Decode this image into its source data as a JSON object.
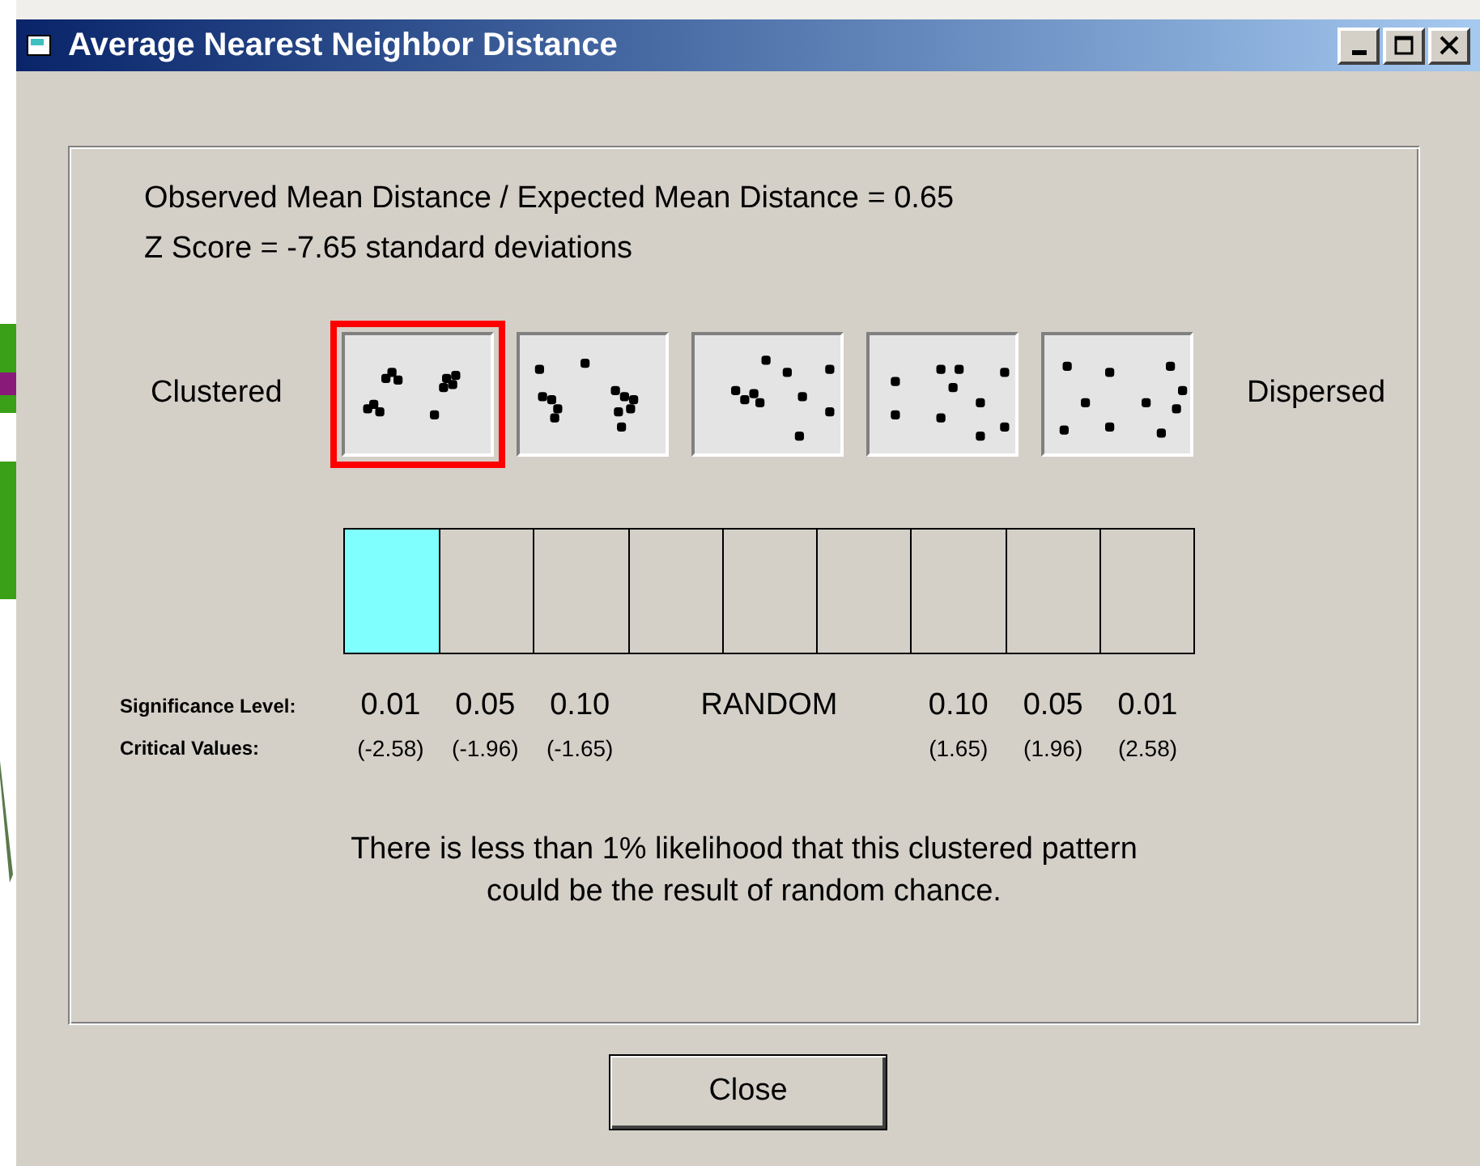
{
  "window": {
    "title": "Average Nearest Neighbor Distance"
  },
  "summary": [
    "Observed Mean Distance / Expected Mean Distance = 0.65",
    "Z Score = -7.65 standard deviations"
  ],
  "ends": {
    "left": "Clustered",
    "right": "Dispersed"
  },
  "patterns": [
    {
      "selected": true
    },
    {
      "selected": false
    },
    {
      "selected": false
    },
    {
      "selected": false
    },
    {
      "selected": false
    }
  ],
  "scale": {
    "cells": [
      {
        "selected": true
      },
      {
        "selected": false
      },
      {
        "selected": false
      },
      {
        "selected": false
      },
      {
        "selected": false
      },
      {
        "selected": false
      },
      {
        "selected": false
      },
      {
        "selected": false
      },
      {
        "selected": false
      }
    ],
    "significance_heading": "Significance Level:",
    "critical_heading": "Critical Values:",
    "columns": [
      {
        "kind": "level",
        "significance": "0.01",
        "critical": "(-2.58)"
      },
      {
        "kind": "level",
        "significance": "0.05",
        "critical": "(-1.96)"
      },
      {
        "kind": "level",
        "significance": "0.10",
        "critical": "(-1.65)"
      },
      {
        "kind": "random",
        "significance": "RANDOM"
      },
      {
        "kind": "level",
        "significance": "0.10",
        "critical": "(1.65)"
      },
      {
        "kind": "level",
        "significance": "0.05",
        "critical": "(1.96)"
      },
      {
        "kind": "level",
        "significance": "0.01",
        "critical": "(2.58)"
      }
    ]
  },
  "message": [
    "There is less than 1% likelihood that this clustered pattern",
    "could be the result of random chance."
  ],
  "close_button": "Close"
}
